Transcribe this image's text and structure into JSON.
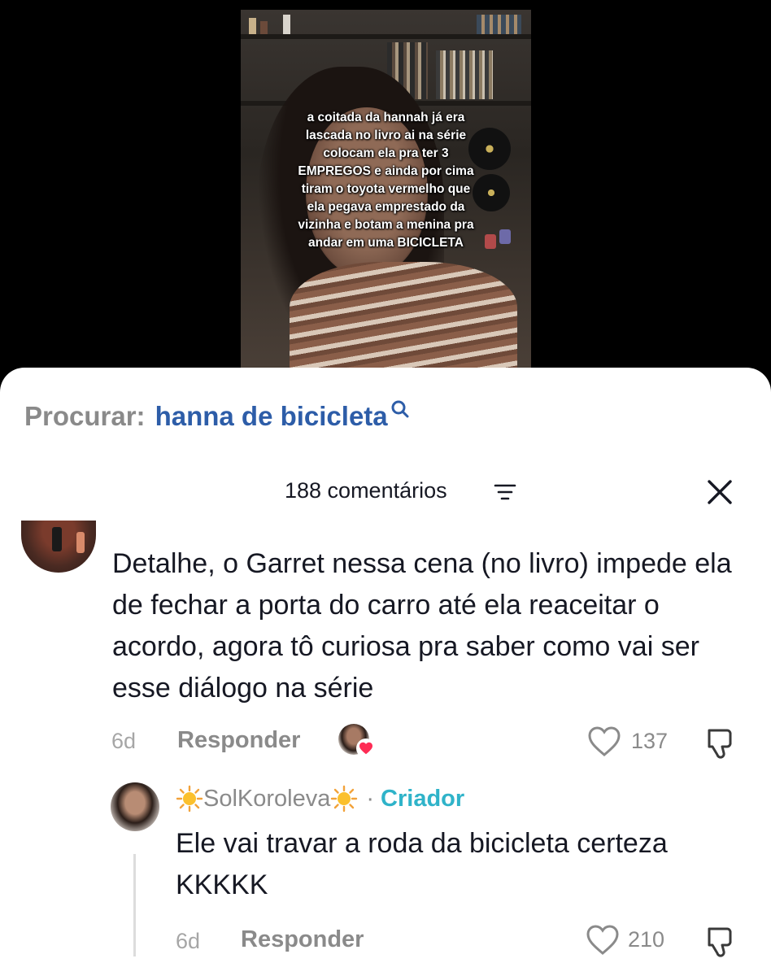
{
  "video": {
    "caption_lines": [
      "a coitada da hannah já era",
      "lascada no livro ai na série",
      "colocam ela pra ter 3",
      "EMPREGOS e ainda por cima",
      "tiram o toyota vermelho que",
      "ela pegava emprestado da",
      "vizinha e botam a menina pra",
      "andar em uma BICICLETA"
    ]
  },
  "search": {
    "prefix": "Procurar:",
    "term": "hanna de bicicleta",
    "icon": "search-icon"
  },
  "comments_header": {
    "count_label": "188 comentários",
    "filter_icon": "filter-icon",
    "close_icon": "close-icon"
  },
  "comment": {
    "text": "Detalhe, o Garret nessa cena (no livro) impede ela de fechar a porta do carro até ela reaceitar o acordo, agora tô curiosa pra saber como vai ser esse diálogo na série",
    "time": "6d",
    "reply_label": "Responder",
    "likes": "137",
    "liked_by_creator": true,
    "heart_color": "#fe2c55"
  },
  "reply": {
    "author": "SolKoroleva",
    "separator": "·",
    "badge": "Criador",
    "badge_color": "#2fb3c9",
    "text": "Ele vai travar a roda da bicicleta certeza KKKKK",
    "time": "6d",
    "reply_label": "Responder",
    "likes": "210"
  }
}
